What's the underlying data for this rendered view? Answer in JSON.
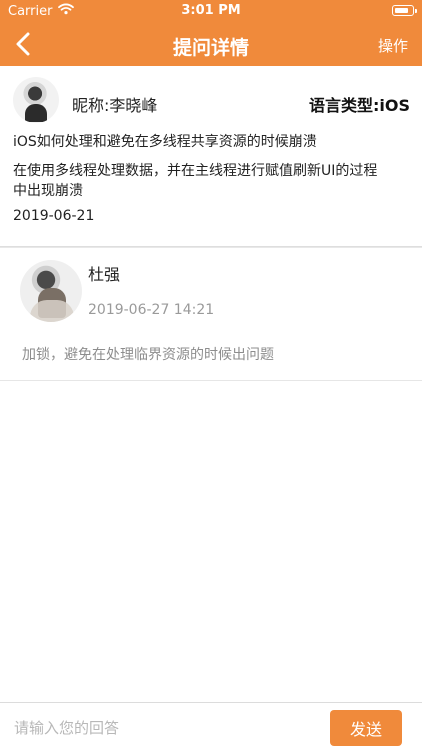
{
  "status_bar": {
    "carrier": "Carrier",
    "time": "3:01 PM"
  },
  "nav": {
    "title": "提问详情",
    "action_label": "操作"
  },
  "question": {
    "nickname": "昵称:李晓峰",
    "language": "语言类型:iOS",
    "title": "iOS如何处理和避免在多线程共享资源的时候崩溃",
    "detail": "在使用多线程处理数据，并在主线程进行赋值刷新UI的过程中出现崩溃",
    "date": "2019-06-21"
  },
  "answer": {
    "author": "杜强",
    "time": "2019-06-27 14:21",
    "content": "加锁，避免在处理临界资源的时候出问题"
  },
  "input": {
    "placeholder": "请输入您的回答",
    "send_label": "发送"
  },
  "colors": {
    "accent": "#f08a3b"
  },
  "icons": {
    "back": "chevron-left-icon",
    "wifi": "wifi-icon",
    "battery": "battery-icon"
  }
}
